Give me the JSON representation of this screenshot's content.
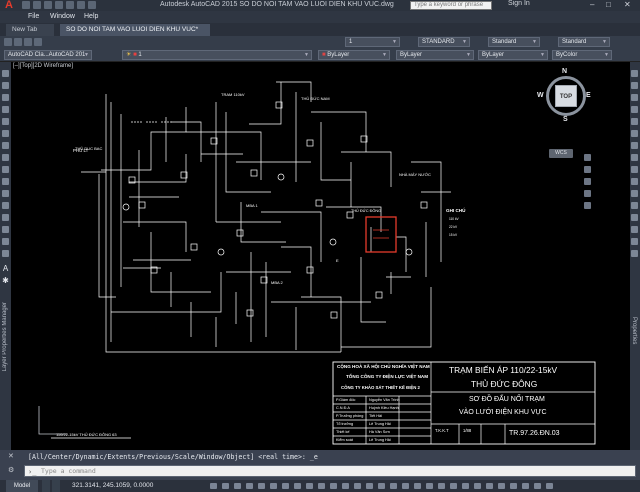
{
  "window": {
    "title": "Autodesk AutoCAD 2015    SO DO NOI TAM VAO LUOI DIEN KHU VUC.dwg",
    "search_placeholder": "Type a keyword or phrase",
    "signin": "Sign In",
    "minimize": "–",
    "maximize": "□",
    "close": "✕"
  },
  "menu": [
    "File",
    "Window",
    "Help"
  ],
  "tabs": {
    "new_tab": "New Tab",
    "active_tab": "SO DO NOI TAM VAO LUOI DIEN KHU VUC*"
  },
  "toolbar1": {
    "layer_value": "1",
    "text_style": "STANDARD",
    "dim_style": "Standard",
    "table_style": "Standard",
    "mleader_style": "Standard"
  },
  "toolbar2": {
    "workspace": "AutoCAD Cla...AutoCAD 201",
    "layer_current": "1",
    "color": "ByLayer",
    "linetype": "ByLayer",
    "lineweight": "ByLayer",
    "plotstyle": "ByColor"
  },
  "viewport": {
    "label": "[–][Top][2D Wireframe]"
  },
  "viewcube": {
    "face": "TOP",
    "north": "N",
    "south": "S",
    "east": "E",
    "west": "W",
    "wcs": "WCS"
  },
  "side_palettes": {
    "left": "Layer Properties Manager",
    "right": "Properties"
  },
  "drawing_labels": {
    "feeder_left": "PHỦ LT",
    "ghichu": "GHI CHÚ",
    "bottom_note": "110/22-15kV THỦ ĐỨC ĐÔNG 63",
    "substation": "THỦ ĐỨC ĐÔNG"
  },
  "title_block": {
    "org1": "CỘNG HOÀ XÃ HỘI CHỦ NGHĨA VIỆT NAM",
    "org2": "TỔNG CÔNG TY ĐIỆN LỰC VIỆT NAM",
    "org3": "CÔNG TY KHẢO SÁT THIẾT KẾ ĐIỆN 2",
    "project_line1": "TRẠM BIẾN ÁP 110/22-15kV",
    "project_line2": "THỦ  ĐỨC ĐÔNG",
    "drawing_line1": "SƠ ĐỒ ĐẤU NỐI TRẠM",
    "drawing_line2": "VÀO LƯỚI ĐIỆN KHU VỰC",
    "drawing_number": "TR.97.26.ĐN.03",
    "stage_label": "T.K.K.T",
    "scale": "1/88",
    "roles": [
      "P.Giám đốc",
      "C.N.Đ.A",
      "P.Trưởng phòng",
      "Tổ trưởng",
      "Thiết kế",
      "Kiểm soát"
    ],
    "names": [
      "Nguyễn Văn Trình",
      "Huỳnh Kiều Hạnh",
      "Tiết Hải",
      "Lê Trung Hải",
      "Hà Văn Sơn",
      "Lê Trung Hải"
    ]
  },
  "command": {
    "history": "[All/Center/Dynamic/Extents/Previous/Scale/Window/Object] <real time>: _e",
    "placeholder": "Type a command"
  },
  "status": {
    "model_tab": "Model",
    "coords": "321.3141, 245.1059, 0.0000"
  }
}
